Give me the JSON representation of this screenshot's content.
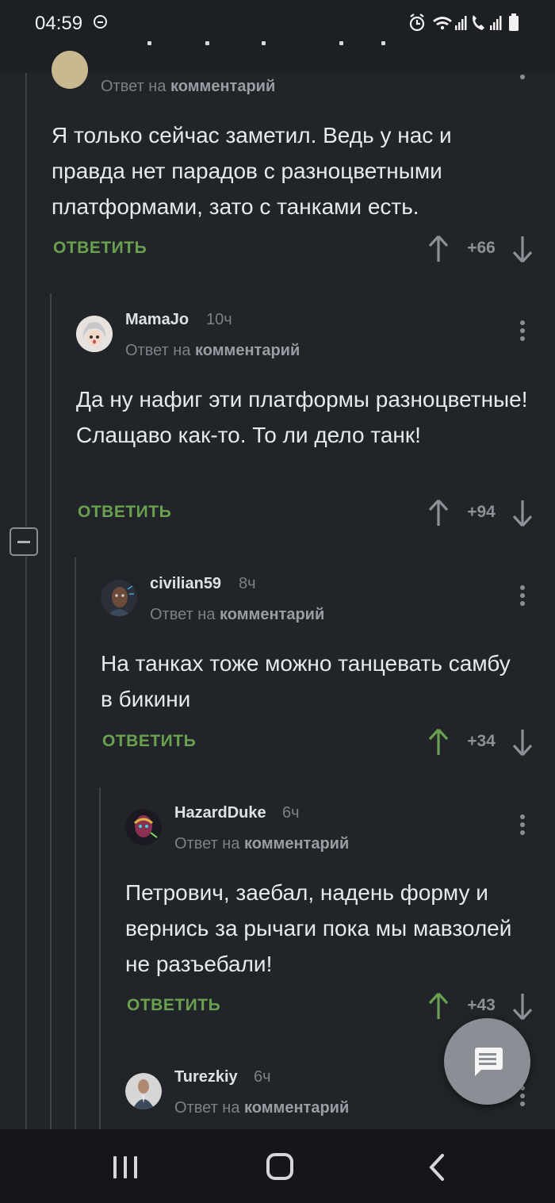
{
  "status_bar": {
    "time": "04:59",
    "icons": [
      "dnd-icon",
      "alarm-icon",
      "wifi-icon",
      "signal-icon",
      "call-icon",
      "signal-icon",
      "battery-icon"
    ]
  },
  "reply_label": "ОТВЕТИТЬ",
  "comments": [
    {
      "username": "",
      "time": "",
      "reply_prefix": "Ответ на",
      "reply_link": "комментарий",
      "text": "Я только сейчас заметил. Ведь у нас и правда нет парадов с разноцветными платформами, зато с танками есть.",
      "score": "+66",
      "voted_up": false
    },
    {
      "username": "MamaJo",
      "time": "10ч",
      "reply_prefix": "Ответ на",
      "reply_link": "комментарий",
      "text": "Да ну нафиг эти платформы разноцветные! Слащаво как-то. То ли дело танк!",
      "score": "+94",
      "voted_up": false
    },
    {
      "username": "civilian59",
      "time": "8ч",
      "reply_prefix": "Ответ на",
      "reply_link": "комментарий",
      "text": "На танках тоже можно танцевать самбу в бикини",
      "score": "+34",
      "voted_up": true
    },
    {
      "username": "HazardDuke",
      "time": "6ч",
      "reply_prefix": "Ответ на",
      "reply_link": "комментарий",
      "text": "Петрович, заебал, надень форму и вернись за рычаги пока мы мавзолей не разъебали!",
      "score": "+43",
      "voted_up": true
    },
    {
      "username": "Turezkiy",
      "time": "6ч",
      "reply_prefix": "Ответ на",
      "reply_link": "комментарий",
      "text": "",
      "score": "",
      "voted_up": false
    }
  ],
  "colors": {
    "background": "#212429",
    "accent_green": "#6aa14f",
    "muted": "#7d8187"
  },
  "fab_icon": "comment-icon",
  "nav_bar": [
    "recents-icon",
    "home-icon",
    "back-icon"
  ]
}
